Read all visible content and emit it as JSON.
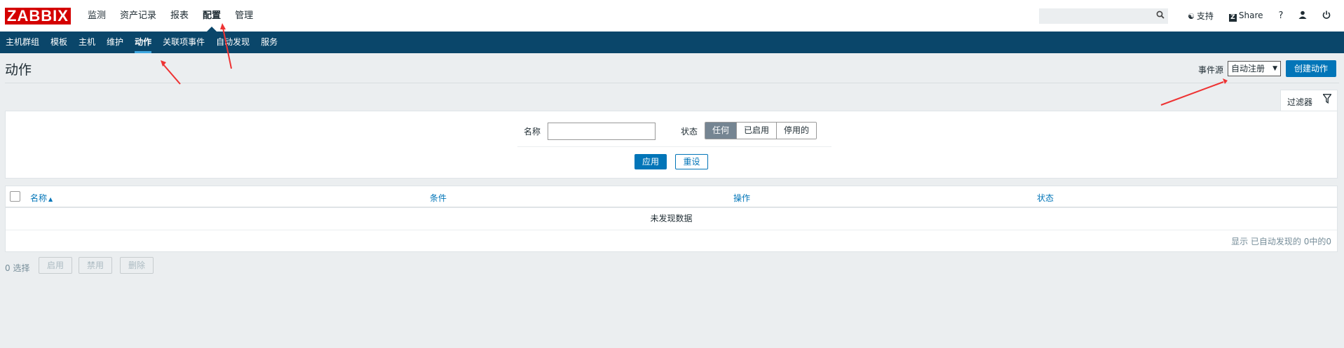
{
  "header": {
    "logo_text": "ZABBIX",
    "main_nav": [
      {
        "label": "监测",
        "active": false
      },
      {
        "label": "资产记录",
        "active": false
      },
      {
        "label": "报表",
        "active": false
      },
      {
        "label": "配置",
        "active": true
      },
      {
        "label": "管理",
        "active": false
      }
    ],
    "search_placeholder": "",
    "support_label": "支持",
    "share_label": "Share",
    "help_label": "?",
    "icons": [
      "search-icon",
      "headset-icon",
      "share-icon",
      "help-icon",
      "user-icon",
      "power-icon"
    ]
  },
  "sub_nav": [
    {
      "label": "主机群组",
      "active": false
    },
    {
      "label": "模板",
      "active": false
    },
    {
      "label": "主机",
      "active": false
    },
    {
      "label": "维护",
      "active": false
    },
    {
      "label": "动作",
      "active": true
    },
    {
      "label": "关联项事件",
      "active": false
    },
    {
      "label": "自动发现",
      "active": false
    },
    {
      "label": "服务",
      "active": false
    }
  ],
  "page": {
    "title": "动作",
    "event_source_label": "事件源",
    "event_source_value": "自动注册",
    "create_button": "创建动作"
  },
  "filter": {
    "tab_label": "过滤器",
    "name_label": "名称",
    "name_value": "",
    "status_label": "状态",
    "status_options": [
      {
        "label": "任何",
        "selected": true
      },
      {
        "label": "已启用",
        "selected": false
      },
      {
        "label": "停用的",
        "selected": false
      }
    ],
    "apply_button": "应用",
    "reset_button": "重设"
  },
  "table": {
    "columns": [
      "名称",
      "条件",
      "操作",
      "状态"
    ],
    "sorted_column": "名称",
    "sort_direction": "ascending",
    "empty_text": "未发现数据",
    "footer_text": "显示 已自动发现的 0中的0"
  },
  "bottom_actions": {
    "selected_count": "0 选择",
    "buttons": [
      "启用",
      "禁用",
      "删除"
    ]
  },
  "colors": {
    "brand_red": "#d40000",
    "subnav_bg": "#0a466a",
    "primary_button": "#0275b8",
    "annotation_arrow": "#ee3333"
  }
}
